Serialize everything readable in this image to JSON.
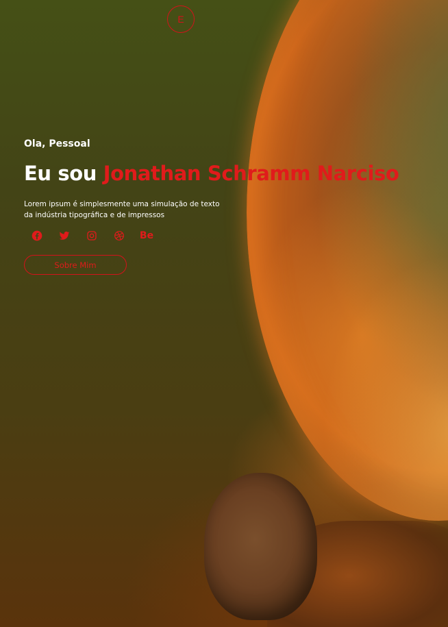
{
  "logo": {
    "letter": "E"
  },
  "hero": {
    "greeting": "Ola, Pessoal",
    "headline_prefix": "Eu sou",
    "headline_name": "Jonathan Schramm Narciso",
    "description_line1": "Lorem ipsum é simplesmente uma simulação de texto",
    "description_line2": "da indústria tipográfica e de impressos",
    "button_label": "Sobre Mim"
  },
  "socials": [
    {
      "icon": "facebook-icon"
    },
    {
      "icon": "twitter-icon"
    },
    {
      "icon": "instagram-icon"
    },
    {
      "icon": "dribbble-icon"
    },
    {
      "icon": "behance-icon",
      "text": "Be"
    }
  ],
  "colors": {
    "accent": "#e01b1b",
    "text": "#ffffff",
    "background": "#434416"
  }
}
